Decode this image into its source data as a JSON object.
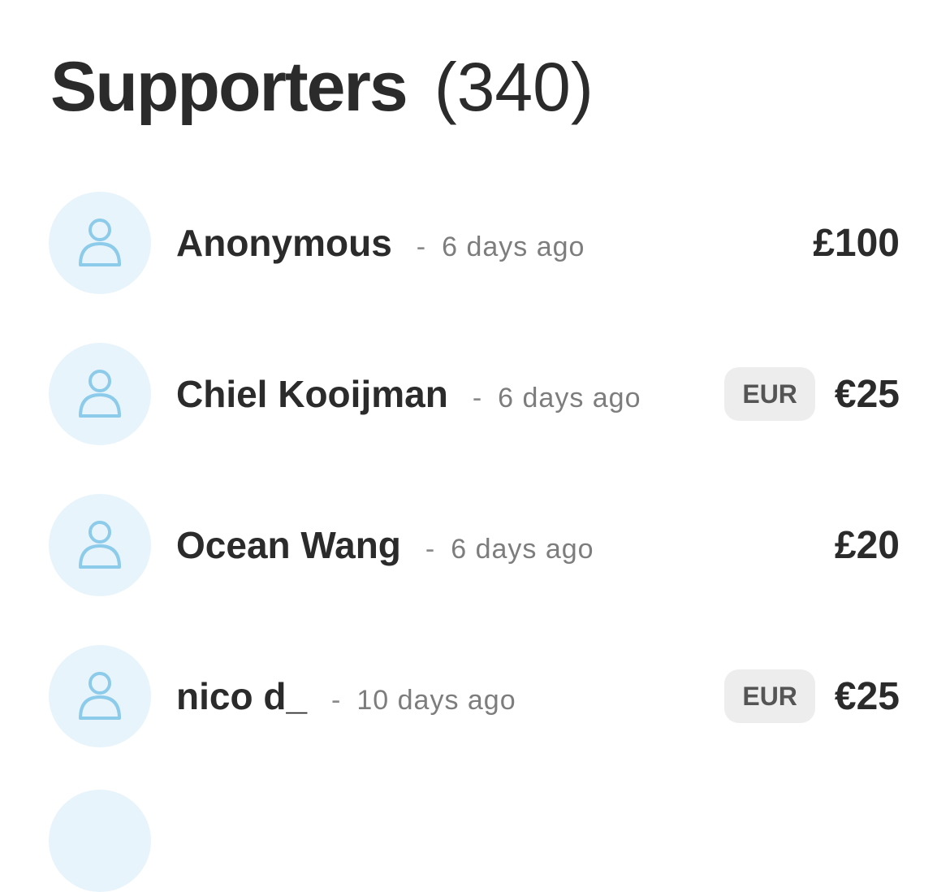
{
  "header": {
    "title": "Supporters",
    "count": "(340)"
  },
  "colors": {
    "avatar_bg": "#e8f4fb",
    "avatar_icon": "#8ccbea",
    "badge_bg": "#ededed",
    "text_primary": "#2b2b2b",
    "text_secondary": "#7d7d7d"
  },
  "supporters": [
    {
      "name": "Anonymous",
      "separator": "-",
      "time": "6 days ago",
      "currency_badge": "",
      "amount": "£100",
      "icon": "person-icon"
    },
    {
      "name": "Chiel Kooijman",
      "separator": "-",
      "time": "6 days ago",
      "currency_badge": "EUR",
      "amount": "€25",
      "icon": "person-icon"
    },
    {
      "name": "Ocean Wang",
      "separator": "-",
      "time": "6 days ago",
      "currency_badge": "",
      "amount": "£20",
      "icon": "person-icon"
    },
    {
      "name": "nico d_",
      "separator": "-",
      "time": "10 days ago",
      "currency_badge": "EUR",
      "amount": "€25",
      "icon": "person-icon"
    }
  ]
}
